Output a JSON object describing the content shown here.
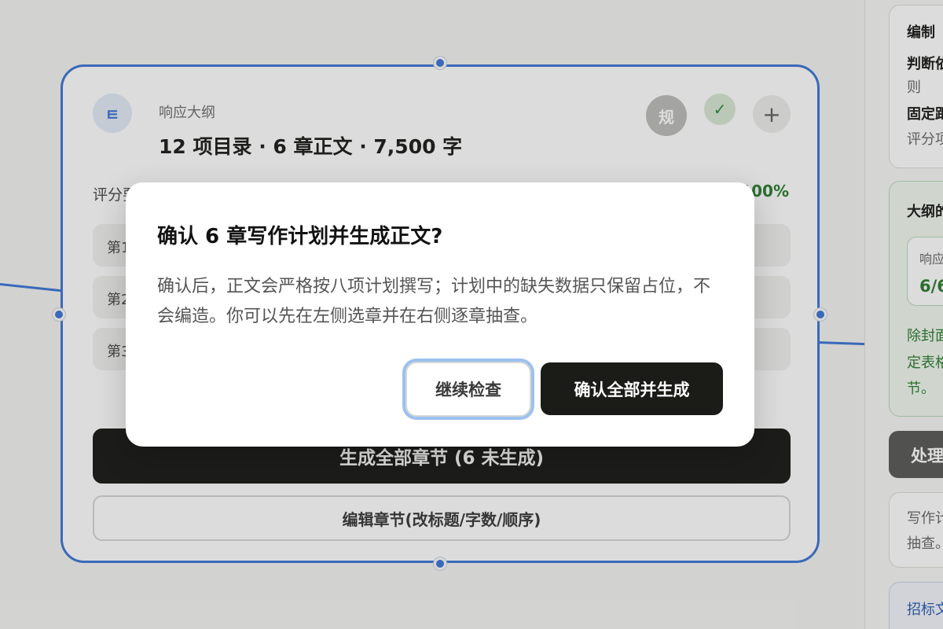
{
  "outline_card": {
    "icon": "outline-list-icon",
    "icon_text": "ㅌ",
    "kicker": "响应大纲",
    "title": "12 项目录 · 6 章正文 · 7,500 字",
    "rule_badge": "规",
    "score_label": "评分要",
    "score_value": "100%",
    "chapter_rows": [
      "第1",
      "第2",
      "第3"
    ],
    "generate_all_label": "生成全部章节 (6 未生成)",
    "edit_label": "编辑章节(改标题/字数/顺序)"
  },
  "sidebar": {
    "panel1": [
      "编制",
      "判断依",
      "则",
      "固定距",
      "评分项"
    ],
    "panel2_title": "大纲的",
    "panel2_inner_label": "响应",
    "panel2_inner_value": "6/6",
    "panel2_text": [
      "除封面",
      "定表格",
      "节。"
    ],
    "action_label": "处理",
    "panel3_text": [
      "写作计",
      "抽查。"
    ],
    "panel4_text": "招标文"
  },
  "modal": {
    "title": "确认 6 章写作计划并生成正文?",
    "body": "确认后，正文会严格按八项计划撰写；计划中的缺失数据只保留占位，不会编造。你可以先在左侧选章并在右侧逐章抽查。",
    "continue_label": "继续检查",
    "confirm_label": "确认全部并生成"
  },
  "colors": {
    "accent": "#3e76d6",
    "primary_button": "#1b1b18",
    "success": "#2e7d32"
  }
}
